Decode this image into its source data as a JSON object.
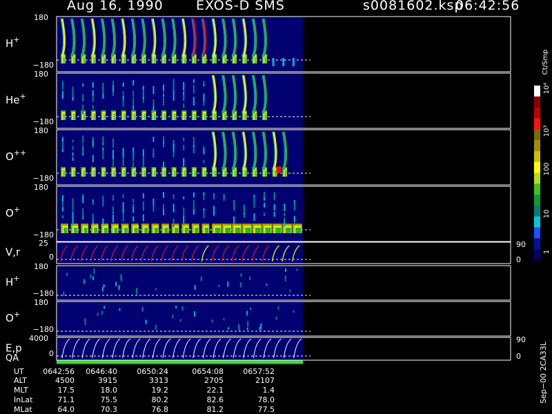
{
  "header": {
    "date": "Aug 16, 1990",
    "instrument": "EXOS-D SMS",
    "filename": "s0081602.ksp",
    "time": "06:42:56"
  },
  "colorbar": {
    "unit_label": "Ct/Smp",
    "tick_labels": [
      "10⁴",
      "10³",
      "100",
      "10",
      "1"
    ],
    "colors": [
      "#ffffff",
      "#8b0000",
      "#c00000",
      "#ff1010",
      "#7a6a00",
      "#a09000",
      "#c8c000",
      "#ffff00",
      "#b0e010",
      "#40c020",
      "#109a30",
      "#008070",
      "#00c8d8",
      "#2050ff",
      "#0010a0",
      "#000070"
    ]
  },
  "background_color": "#000070",
  "panels": [
    {
      "label": "H",
      "sup": "+",
      "ticks": [
        "180",
        "−180"
      ],
      "kind": "spectrogram"
    },
    {
      "label": "He",
      "sup": "+",
      "ticks": [
        "180",
        "−180"
      ],
      "kind": "spectrogram"
    },
    {
      "label": "O",
      "sup": "++",
      "ticks": [
        "180",
        "−180"
      ],
      "kind": "spectrogram"
    },
    {
      "label": "O",
      "sup": "+",
      "ticks": [
        "180",
        "−180"
      ],
      "kind": "spectrogram"
    },
    {
      "label": "V,r",
      "sup": "",
      "ticks": [
        "25",
        "0"
      ],
      "right_ticks": [
        "90",
        "0"
      ],
      "kind": "trace"
    },
    {
      "label": "H",
      "sup": "+",
      "ticks": [
        "180",
        "−180"
      ],
      "kind": "sparse"
    },
    {
      "label": "O",
      "sup": "+",
      "ticks": [
        "180",
        "−180"
      ],
      "kind": "sparse"
    },
    {
      "label": "E,p",
      "sup": "",
      "label2": "QA",
      "ticks": [
        "4000",
        "0"
      ],
      "right_ticks": [
        "90",
        "0"
      ],
      "kind": "ep"
    }
  ],
  "footer": {
    "rows": [
      {
        "label": "UT",
        "values": [
          "0642:56",
          "0646:40",
          "0650:24",
          "0654:08",
          "0657:52"
        ]
      },
      {
        "label": "ALT",
        "values": [
          "4500",
          "3915",
          "3313",
          "2705",
          "2107"
        ]
      },
      {
        "label": "MLT",
        "values": [
          "17.5",
          "18.0",
          "19.2",
          "22.1",
          "1.4"
        ]
      },
      {
        "label": "InLat",
        "values": [
          "71.1",
          "75.5",
          "80.2",
          "82.6",
          "78.0"
        ]
      },
      {
        "label": "MLat",
        "values": [
          "64.0",
          "70.3",
          "76.8",
          "81.2",
          "77.5"
        ]
      }
    ],
    "side_label": "Sep−00 2CA33L"
  },
  "chart_data": {
    "type": "heatmap",
    "title": "Aug 16, 1990   EXOS-D SMS",
    "x_tick_labels": [
      "0642:56",
      "0646:40",
      "0650:24",
      "0654:08",
      "0657:52"
    ],
    "colorscale_label": "Ct/Smp",
    "colorscale_ticks": [
      "1",
      "10",
      "100",
      "10³",
      "10⁴"
    ]
  }
}
